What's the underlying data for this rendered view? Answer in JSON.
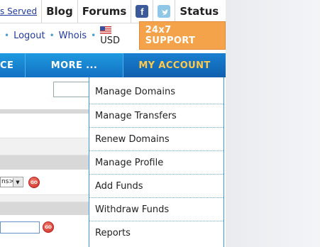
{
  "toplinks": {
    "served": "s Served",
    "blog": "Blog",
    "forums": "Forums",
    "facebook_glyph": "f",
    "twitter_glyph": "t",
    "status": "Status"
  },
  "row2": {
    "logout": "Logout",
    "whois": "Whois",
    "currency": "USD",
    "support": "24x7 SUPPORT"
  },
  "nav": {
    "items": [
      {
        "label": "CE"
      },
      {
        "label": "MORE ..."
      },
      {
        "label": "MY ACCOUNT"
      }
    ],
    "accent_color": "#ffc94a"
  },
  "content": {
    "select_value": "ns>",
    "go_label": "GO"
  },
  "dropdown": {
    "items": [
      {
        "label": "Manage Domains"
      },
      {
        "label": "Manage Transfers"
      },
      {
        "label": "Renew Domains"
      },
      {
        "label": "Manage Profile"
      },
      {
        "label": "Add Funds"
      },
      {
        "label": "Withdraw Funds"
      },
      {
        "label": "Reports"
      }
    ]
  }
}
